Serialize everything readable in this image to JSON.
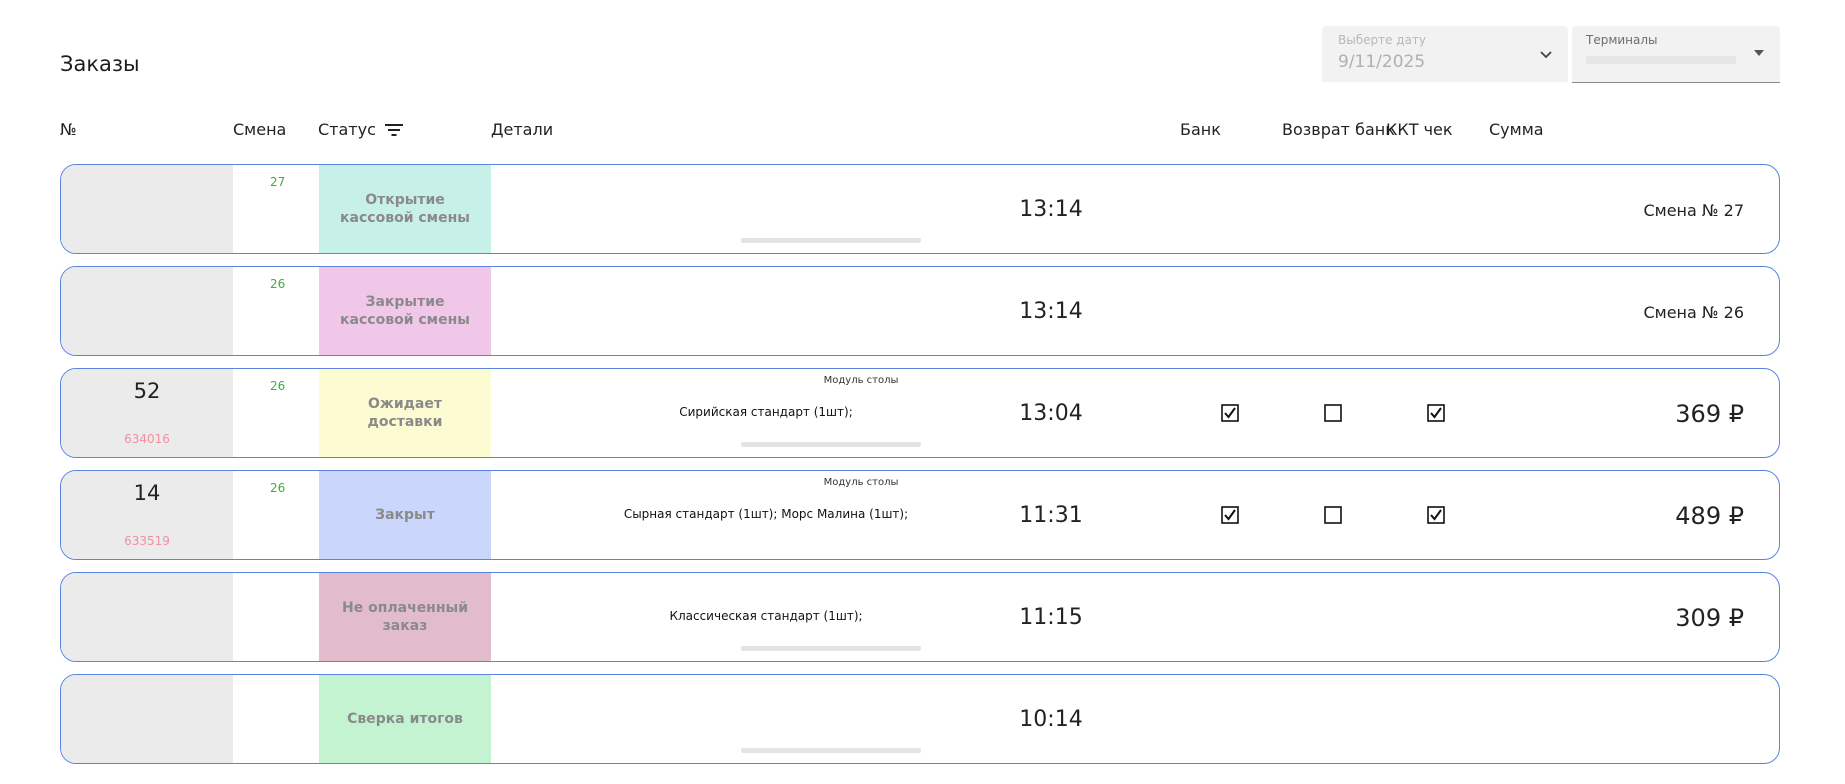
{
  "page": {
    "title": "Заказы"
  },
  "filters": {
    "date": {
      "label": "Выберте дату",
      "value": "9/11/2025"
    },
    "terminal": {
      "label": "Терминалы"
    }
  },
  "columns": {
    "num": "№",
    "shift": "Смена",
    "status": "Статус",
    "details": "Детали",
    "bank": "Банк",
    "refund_bank": "Возврат банк",
    "kkt": "ККТ чек",
    "sum": "Сумма"
  },
  "colors": {
    "row_border": "#5b84e0",
    "status_open": "#c7f0e8",
    "status_close": "#f0c7e8",
    "status_waiting": "#fdfbd2",
    "status_closed": "#cad6fb",
    "status_unpaid": "#e2bccb",
    "status_reconcile": "#c3f3d0",
    "shift_text": "#3fae3f",
    "sub_text": "#f090a0"
  },
  "rows": [
    {
      "num": "",
      "sub": "",
      "shift": "27",
      "status": "Открытие кассовой смены",
      "module": "",
      "details": "",
      "time": "13:14",
      "bank": null,
      "refund": null,
      "kkt": null,
      "sum": "Смена № 27"
    },
    {
      "num": "",
      "sub": "",
      "shift": "26",
      "status": "Закрытие кассовой смены",
      "module": "",
      "details": "",
      "time": "13:14",
      "bank": null,
      "refund": null,
      "kkt": null,
      "sum": "Смена № 26"
    },
    {
      "num": "52",
      "sub": "634016",
      "shift": "26",
      "status": "Ожидает доставки",
      "module": "Модуль столы",
      "details": "Сирийская стандарт (1шт);",
      "time": "13:04",
      "bank": true,
      "refund": false,
      "kkt": true,
      "sum": "369 ₽"
    },
    {
      "num": "14",
      "sub": "633519",
      "shift": "26",
      "status": "Закрыт",
      "module": "Модуль столы",
      "details": "Сырная стандарт (1шт); Морс Малина (1шт);",
      "time": "11:31",
      "bank": true,
      "refund": false,
      "kkt": true,
      "sum": "489 ₽"
    },
    {
      "num": "",
      "sub": "",
      "shift": "",
      "status": "Не оплаченный заказ",
      "module": "",
      "details": "Классическая стандарт (1шт);",
      "time": "11:15",
      "bank": null,
      "refund": null,
      "kkt": null,
      "sum": "309 ₽"
    },
    {
      "num": "",
      "sub": "",
      "shift": "",
      "status": "Сверка итогов",
      "module": "",
      "details": "",
      "time": "10:14",
      "bank": null,
      "refund": null,
      "kkt": null,
      "sum": ""
    }
  ]
}
